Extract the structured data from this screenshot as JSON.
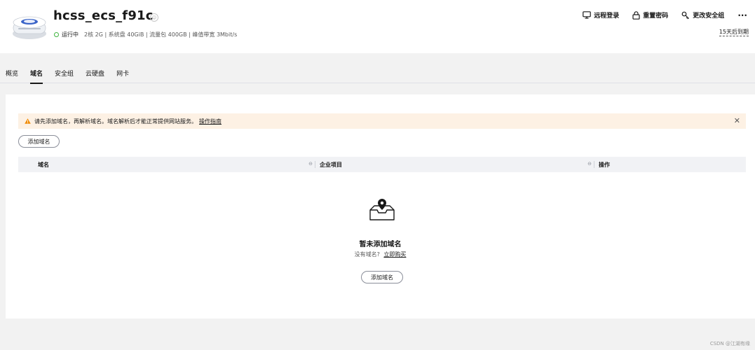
{
  "header": {
    "title": "hcss_ecs_f91c",
    "status": "运行中",
    "specs": "2核  2G | 系统盘 40GiB | 流量包 400GB | 峰值带宽 3Mbit/s",
    "actions": [
      {
        "label": "远程登录",
        "icon": "monitor-icon"
      },
      {
        "label": "重置密码",
        "icon": "lock-icon"
      },
      {
        "label": "更改安全组",
        "icon": "shield-key-icon"
      }
    ],
    "more": "···",
    "expire": "15天后到期"
  },
  "tabs": [
    {
      "label": "概览",
      "active": false
    },
    {
      "label": "域名",
      "active": true
    },
    {
      "label": "安全组",
      "active": false
    },
    {
      "label": "云硬盘",
      "active": false
    },
    {
      "label": "网卡",
      "active": false
    }
  ],
  "notice": {
    "text": "请先添加域名，再解析域名。域名解析后才能正常提供网站服务。",
    "link": "操作指南",
    "close": "✕"
  },
  "add_domain_label": "添加域名",
  "table": {
    "columns": [
      "域名",
      "企业项目",
      "操作"
    ]
  },
  "empty": {
    "title": "暂未添加域名",
    "sub": "没有域名?",
    "buy_link": "立即购买",
    "button": "添加域名"
  },
  "watermark": "CSDN @江湖有缘",
  "colors": {
    "status_green": "#3fb43f",
    "notice_bg": "#fdf1e4",
    "warn_orange": "#f08a00"
  }
}
